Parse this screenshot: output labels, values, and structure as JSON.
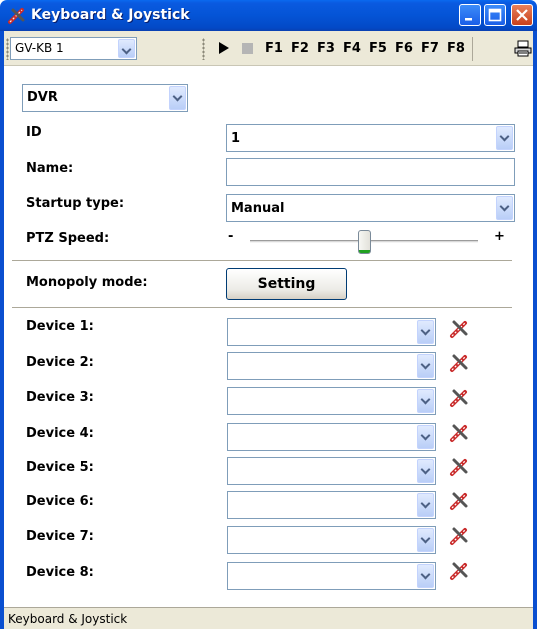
{
  "window": {
    "title": "Keyboard & Joystick",
    "accent": "#0454d6"
  },
  "toolbar": {
    "keyboard_select": "GV-KB 1",
    "play_icon": "play-icon",
    "stop_icon": "stop-icon",
    "function_keys": [
      "F1",
      "F2",
      "F3",
      "F4",
      "F5",
      "F6",
      "F7",
      "F8"
    ],
    "print_icon": "printer-icon"
  },
  "form": {
    "device_type": "DVR",
    "id_label": "ID",
    "id_value": "1",
    "name_label": "Name:",
    "name_value": "",
    "startup_label": "Startup type:",
    "startup_value": "Manual",
    "ptz_label": "PTZ Speed:",
    "ptz_min": "-",
    "ptz_max": "+",
    "ptz_level": 0.5,
    "monopoly_label": "Monopoly mode:",
    "setting_button": "Setting"
  },
  "devices": [
    {
      "label": "Device 1:",
      "value": ""
    },
    {
      "label": "Device 2:",
      "value": ""
    },
    {
      "label": "Device 3:",
      "value": ""
    },
    {
      "label": "Device 4:",
      "value": ""
    },
    {
      "label": "Device 5:",
      "value": ""
    },
    {
      "label": "Device 6:",
      "value": ""
    },
    {
      "label": "Device 7:",
      "value": ""
    },
    {
      "label": "Device 8:",
      "value": ""
    }
  ],
  "status": {
    "text": "Keyboard & Joystick"
  }
}
